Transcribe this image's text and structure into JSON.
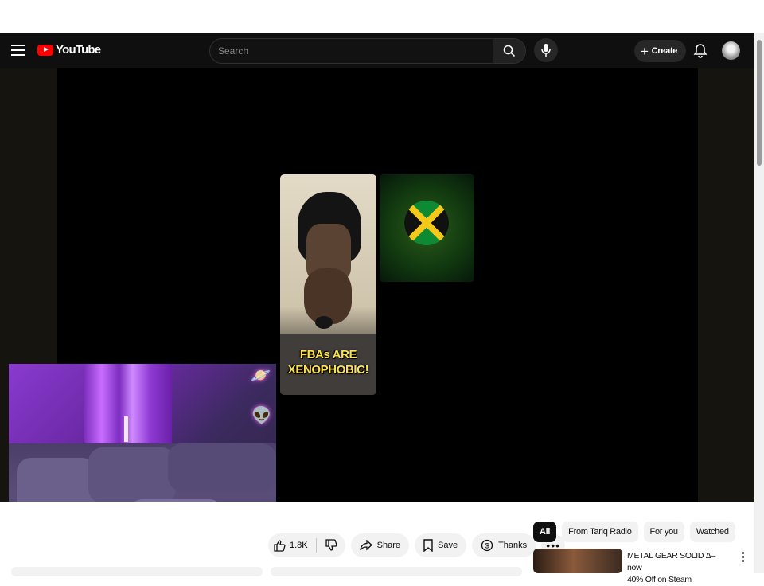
{
  "header": {
    "logo_text": "YouTube",
    "search_placeholder": "Search",
    "create_label": "Create"
  },
  "video": {
    "caption_line1": "FBAs ARE",
    "caption_line2": "XENOPHOBIC!"
  },
  "actions": {
    "like_count": "1.8K",
    "share_label": "Share",
    "save_label": "Save",
    "thanks_label": "Thanks",
    "more_label": "•••"
  },
  "chips": [
    "All",
    "From Tariq Radio",
    "For you",
    "Watched"
  ],
  "recommendation": {
    "title_line1": "METAL GEAR SOLID Δ– now",
    "title_line2": "40% Off on Steam"
  },
  "colors": {
    "header_bg": "#0f0f0f",
    "brand_red": "#ff0000",
    "caption_yellow": "#ffe34d"
  }
}
